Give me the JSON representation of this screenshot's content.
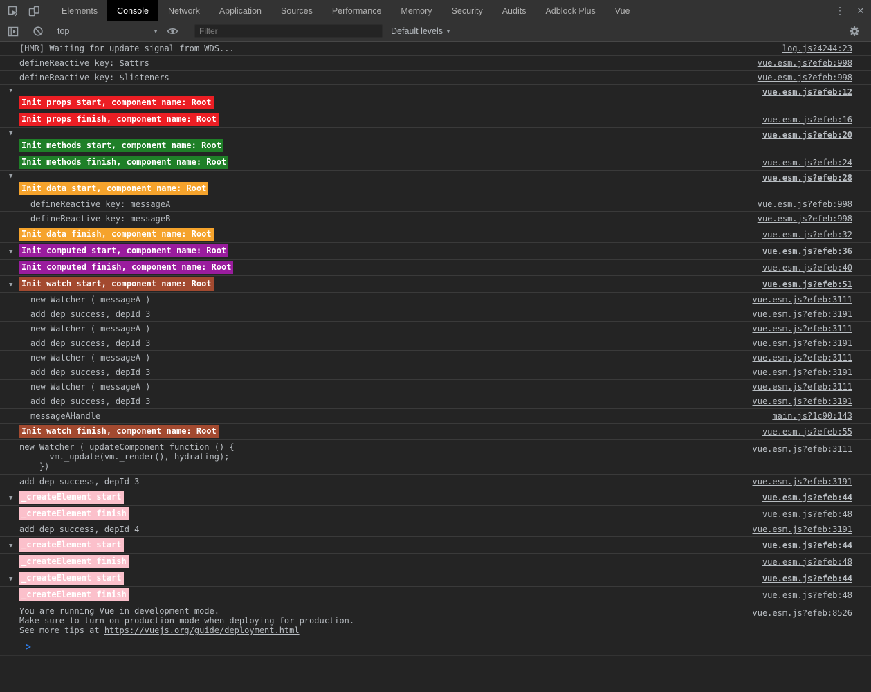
{
  "tabbar": {
    "tabs": [
      "Elements",
      "Console",
      "Network",
      "Application",
      "Sources",
      "Performance",
      "Memory",
      "Security",
      "Audits",
      "Adblock Plus",
      "Vue"
    ],
    "active_tab": "Console"
  },
  "toolbar": {
    "context_label": "top",
    "filter_placeholder": "Filter",
    "levels_label": "Default levels"
  },
  "icons": {
    "more": "⋮",
    "close": "✕",
    "caret": "▼",
    "disclosure": "▼",
    "prompt": ">"
  },
  "colors": {
    "red": "#ec1e24",
    "green": "#1f7f28",
    "orange": "#f5a32c",
    "purple": "#9a1c9e",
    "brown": "#a34a30",
    "pink": "#fbc0cb",
    "prompt_blue": "#2e7de9"
  },
  "console": {
    "rows": [
      {
        "kind": "plain",
        "text": "[HMR] Waiting for update signal from WDS...",
        "link": "log.js?4244:23"
      },
      {
        "kind": "plain",
        "text": "defineReactive key: $attrs",
        "link": "vue.esm.js?efeb:998"
      },
      {
        "kind": "plain",
        "text": "defineReactive key: $listeners",
        "link": "vue.esm.js?efeb:998"
      },
      {
        "kind": "header2",
        "color": "red",
        "text": "Init props start, component name: Root",
        "link": "vue.esm.js?efeb:12",
        "bold": true
      },
      {
        "kind": "badge",
        "color": "red",
        "text": "Init props finish, component name: Root",
        "link": "vue.esm.js?efeb:16"
      },
      {
        "kind": "header2",
        "color": "green",
        "text": "Init methods start, component name: Root",
        "link": "vue.esm.js?efeb:20",
        "bold": true
      },
      {
        "kind": "badge",
        "color": "green",
        "text": "Init methods finish, component name: Root",
        "link": "vue.esm.js?efeb:24"
      },
      {
        "kind": "header2",
        "color": "orange",
        "text": "Init data start, component name: Root",
        "link": "vue.esm.js?efeb:28",
        "bold": true
      },
      {
        "kind": "plain",
        "indent": 1,
        "text": "defineReactive key: messageA",
        "link": "vue.esm.js?efeb:998"
      },
      {
        "kind": "plain",
        "indent": 1,
        "text": "defineReactive key: messageB",
        "link": "vue.esm.js?efeb:998"
      },
      {
        "kind": "badge",
        "color": "orange",
        "text": "Init data finish, component name: Root",
        "link": "vue.esm.js?efeb:32"
      },
      {
        "kind": "header1",
        "color": "purple",
        "text": "Init computed start, component name: Root",
        "link": "vue.esm.js?efeb:36",
        "bold": true
      },
      {
        "kind": "badge",
        "color": "purple",
        "text": "Init computed finish, component name: Root",
        "link": "vue.esm.js?efeb:40"
      },
      {
        "kind": "header1",
        "color": "brown",
        "text": "Init watch start, component name: Root",
        "link": "vue.esm.js?efeb:51",
        "bold": true
      },
      {
        "kind": "plain",
        "indent": 1,
        "text": "new Watcher ( messageA )",
        "link": "vue.esm.js?efeb:3111"
      },
      {
        "kind": "plain",
        "indent": 1,
        "text": "add dep success, depId 3",
        "link": "vue.esm.js?efeb:3191"
      },
      {
        "kind": "plain",
        "indent": 1,
        "text": "new Watcher ( messageA )",
        "link": "vue.esm.js?efeb:3111"
      },
      {
        "kind": "plain",
        "indent": 1,
        "text": "add dep success, depId 3",
        "link": "vue.esm.js?efeb:3191"
      },
      {
        "kind": "plain",
        "indent": 1,
        "text": "new Watcher ( messageA )",
        "link": "vue.esm.js?efeb:3111"
      },
      {
        "kind": "plain",
        "indent": 1,
        "text": "add dep success, depId 3",
        "link": "vue.esm.js?efeb:3191"
      },
      {
        "kind": "plain",
        "indent": 1,
        "text": "new Watcher ( messageA )",
        "link": "vue.esm.js?efeb:3111"
      },
      {
        "kind": "plain",
        "indent": 1,
        "text": "add dep success, depId 3",
        "link": "vue.esm.js?efeb:3191"
      },
      {
        "kind": "plain",
        "indent": 1,
        "text": "messageAHandle",
        "link": "main.js?1c90:143"
      },
      {
        "kind": "badge",
        "color": "brown",
        "text": "Init watch finish, component name: Root",
        "link": "vue.esm.js?efeb:55"
      },
      {
        "kind": "multi",
        "text": "new Watcher ( updateComponent function () {\n      vm._update(vm._render(), hydrating);\n    })",
        "link": "vue.esm.js?efeb:3111"
      },
      {
        "kind": "plain",
        "text": "add dep success, depId 3",
        "link": "vue.esm.js?efeb:3191"
      },
      {
        "kind": "header1",
        "color": "pink",
        "text": "_createElement start",
        "link": "vue.esm.js?efeb:44",
        "bold": true
      },
      {
        "kind": "badge",
        "color": "pink",
        "text": "_createElement finish",
        "link": "vue.esm.js?efeb:48"
      },
      {
        "kind": "plain",
        "text": "add dep success, depId 4",
        "link": "vue.esm.js?efeb:3191"
      },
      {
        "kind": "header1",
        "color": "pink",
        "text": "_createElement start",
        "link": "vue.esm.js?efeb:44",
        "bold": true
      },
      {
        "kind": "badge",
        "color": "pink",
        "text": "_createElement finish",
        "link": "vue.esm.js?efeb:48"
      },
      {
        "kind": "header1",
        "color": "pink",
        "text": "_createElement start",
        "link": "vue.esm.js?efeb:44",
        "bold": true
      },
      {
        "kind": "badge",
        "color": "pink",
        "text": "_createElement finish",
        "link": "vue.esm.js?efeb:48"
      },
      {
        "kind": "info",
        "lines": [
          "You are running Vue in development mode.",
          "Make sure to turn on production mode when deploying for production.",
          "See more tips at "
        ],
        "inline_link": "https://vuejs.org/guide/deployment.html",
        "link": "vue.esm.js?efeb:8526"
      },
      {
        "kind": "prompt"
      }
    ]
  }
}
